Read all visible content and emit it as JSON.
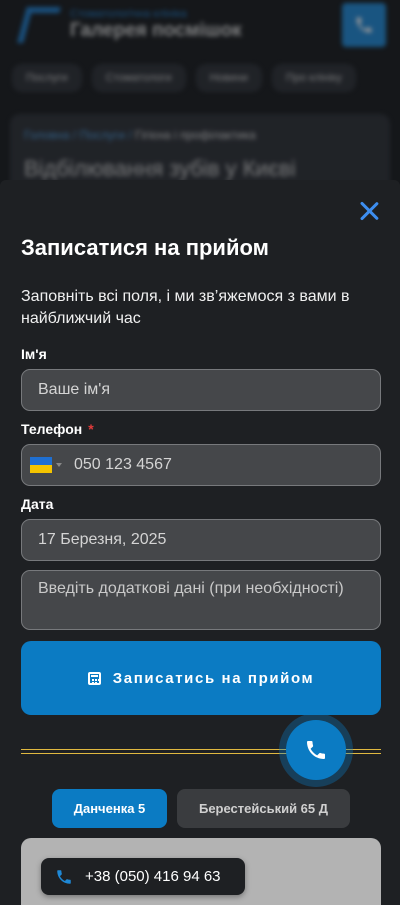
{
  "background": {
    "brand_small": "Стоматологічна клініка",
    "brand_big": "Галерея посмішок",
    "nav": [
      "Послуги",
      "Стоматологи",
      "Новини",
      "Про клініку"
    ],
    "breadcrumb_home": "Головна",
    "breadcrumb_section": "Послуги",
    "breadcrumb_current": "Гігієна і профілактика",
    "heading": "Відбілювання зубів у Києві"
  },
  "modal": {
    "title": "Записатися на прийом",
    "subtitle": "Заповніть всі поля, і ми зв’яжемося з вами в найближчий час",
    "name_label": "Ім'я",
    "name_placeholder": "Ваше ім'я",
    "phone_label": "Телефон",
    "phone_required": "*",
    "phone_value": "050 123 4567",
    "date_label": "Дата",
    "date_value": "17 Березня, 2025",
    "notes_placeholder": "Введіть додаткові дані (при необхідності)",
    "submit_label": "Записатись на прийом"
  },
  "locations": {
    "tabs": [
      "Данченка 5",
      "Берестейський 65 Д"
    ],
    "active_index": 0,
    "phone": "+38 (050) 416 94 63"
  },
  "colors": {
    "accent": "#0b7bc3",
    "close": "#3d8ef0",
    "divider": "#e0b840",
    "required": "#e23b3b"
  }
}
